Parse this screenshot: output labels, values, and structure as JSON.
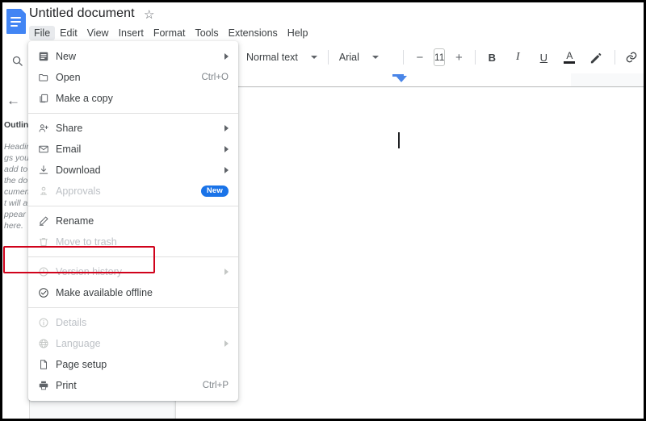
{
  "app": {
    "logo_icon": "google-docs-icon",
    "document_title": "Untitled document",
    "star_icon": "☆"
  },
  "menubar": {
    "items": [
      {
        "label": "File",
        "active": true
      },
      {
        "label": "Edit",
        "active": false
      },
      {
        "label": "View",
        "active": false
      },
      {
        "label": "Insert",
        "active": false
      },
      {
        "label": "Format",
        "active": false
      },
      {
        "label": "Tools",
        "active": false
      },
      {
        "label": "Extensions",
        "active": false
      },
      {
        "label": "Help",
        "active": false
      }
    ]
  },
  "toolbar": {
    "paragraph_style": "Normal text",
    "font_family": "Arial",
    "font_size": "11",
    "decrease_size_icon": "−",
    "increase_size_icon": "+",
    "bold_label": "B",
    "italic_label": "I",
    "underline_label": "U",
    "text_color_label": "A",
    "highlight_icon": "highlight-pen-icon",
    "link_icon": "link-icon",
    "comment_icon": "add-comment-icon",
    "image_icon": "insert-image-icon",
    "align_icon": "align-icon"
  },
  "sidebar": {
    "search_icon": "search-icon",
    "collapse_icon": "←",
    "outline_title": "Outline",
    "outline_empty_text": "Headings you add to the document will appear here."
  },
  "file_menu": {
    "items": [
      {
        "label": "New",
        "icon": "new-document-icon",
        "shortcut": "",
        "submenu": true,
        "disabled": false,
        "badge": ""
      },
      {
        "label": "Open",
        "icon": "folder-icon",
        "shortcut": "Ctrl+O",
        "submenu": false,
        "disabled": false,
        "badge": ""
      },
      {
        "label": "Make a copy",
        "icon": "copy-icon",
        "shortcut": "",
        "submenu": false,
        "disabled": false,
        "badge": ""
      },
      {
        "divider": true
      },
      {
        "label": "Share",
        "icon": "person-add-icon",
        "shortcut": "",
        "submenu": true,
        "disabled": false,
        "badge": ""
      },
      {
        "label": "Email",
        "icon": "email-icon",
        "shortcut": "",
        "submenu": true,
        "disabled": false,
        "badge": ""
      },
      {
        "label": "Download",
        "icon": "download-icon",
        "shortcut": "",
        "submenu": true,
        "disabled": false,
        "badge": ""
      },
      {
        "label": "Approvals",
        "icon": "approvals-icon",
        "shortcut": "",
        "submenu": false,
        "disabled": true,
        "badge": "New"
      },
      {
        "divider": true
      },
      {
        "label": "Rename",
        "icon": "rename-pencil-icon",
        "shortcut": "",
        "submenu": false,
        "disabled": false,
        "badge": ""
      },
      {
        "label": "Move to trash",
        "icon": "trash-icon",
        "shortcut": "",
        "submenu": false,
        "disabled": true,
        "badge": ""
      },
      {
        "divider": true
      },
      {
        "label": "Version history",
        "icon": "history-clock-icon",
        "shortcut": "",
        "submenu": true,
        "disabled": true,
        "badge": ""
      },
      {
        "label": "Make available offline",
        "icon": "offline-check-icon",
        "shortcut": "",
        "submenu": false,
        "disabled": false,
        "badge": "",
        "highlighted": true
      },
      {
        "divider": true
      },
      {
        "label": "Details",
        "icon": "info-icon",
        "shortcut": "",
        "submenu": false,
        "disabled": true,
        "badge": ""
      },
      {
        "label": "Language",
        "icon": "globe-icon",
        "shortcut": "",
        "submenu": true,
        "disabled": true,
        "badge": ""
      },
      {
        "label": "Page setup",
        "icon": "page-setup-icon",
        "shortcut": "",
        "submenu": false,
        "disabled": false,
        "badge": ""
      },
      {
        "label": "Print",
        "icon": "printer-icon",
        "shortcut": "Ctrl+P",
        "submenu": false,
        "disabled": false,
        "badge": ""
      }
    ]
  },
  "document": {
    "caret_visible": true,
    "indent_marker_icon": "indent-marker"
  },
  "colors": {
    "accent": "#1a73e8",
    "highlight_border": "#d0021b",
    "logo": "#4285f4",
    "text": "#3c4043",
    "disabled_text": "#bdc1c6",
    "ruler_marker": "#4a86e8"
  }
}
